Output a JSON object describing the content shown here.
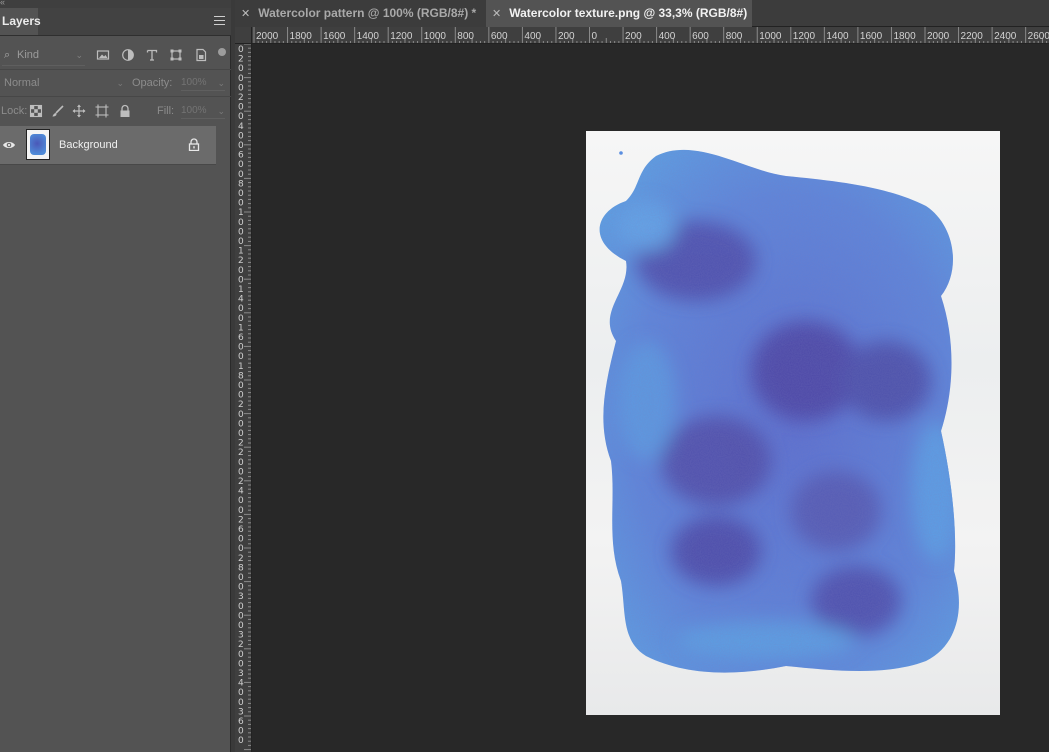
{
  "layers_panel": {
    "title": "Layers",
    "filter": {
      "kind_placeholder": "Kind"
    },
    "blend_mode": "Normal",
    "opacity_label": "Opacity:",
    "opacity_value": "100%",
    "lock_label": "Lock:",
    "fill_label": "Fill:",
    "fill_value": "100%",
    "layers": [
      {
        "name": "Background",
        "visible": true,
        "locked": true
      }
    ]
  },
  "document_tabs": [
    {
      "title": "Watercolor pattern @ 100% (RGB/8#) *",
      "active": false
    },
    {
      "title": "Watercolor texture.png @ 33,3% (RGB/8#)",
      "active": true
    }
  ],
  "ruler": {
    "horizontal_labels": [
      "2000",
      "1800",
      "1600",
      "1400",
      "1200",
      "1000",
      "800",
      "600",
      "400",
      "200",
      "0",
      "200",
      "400",
      "600",
      "800",
      "1000",
      "1200",
      "1400",
      "1600",
      "1800",
      "2000",
      "2200",
      "2400",
      "2600"
    ],
    "vertical_labels": [
      "0",
      "2",
      "0",
      "0",
      "0",
      "2",
      "0",
      "0",
      "4",
      "0",
      "0",
      "6",
      "0",
      "0",
      "8",
      "0",
      "0",
      "1",
      "0",
      "0",
      "0",
      "1",
      "2",
      "0",
      "0",
      "1",
      "4",
      "0",
      "0",
      "1",
      "6",
      "0",
      "0",
      "1",
      "8",
      "0",
      "0",
      "2",
      "0",
      "0",
      "0",
      "2",
      "2",
      "0",
      "0",
      "2",
      "4",
      "0",
      "0",
      "2",
      "6",
      "0",
      "0",
      "2",
      "8",
      "0",
      "0",
      "3",
      "0",
      "0",
      "0",
      "3",
      "2",
      "0",
      "0",
      "3",
      "4",
      "0",
      "0",
      "3",
      "6",
      "0",
      "0"
    ]
  },
  "colors": {
    "panel_bg": "#535353",
    "canvas_bg": "#282828",
    "paint_light": "#5aa2e6",
    "paint_dark": "#4a3fa0"
  }
}
